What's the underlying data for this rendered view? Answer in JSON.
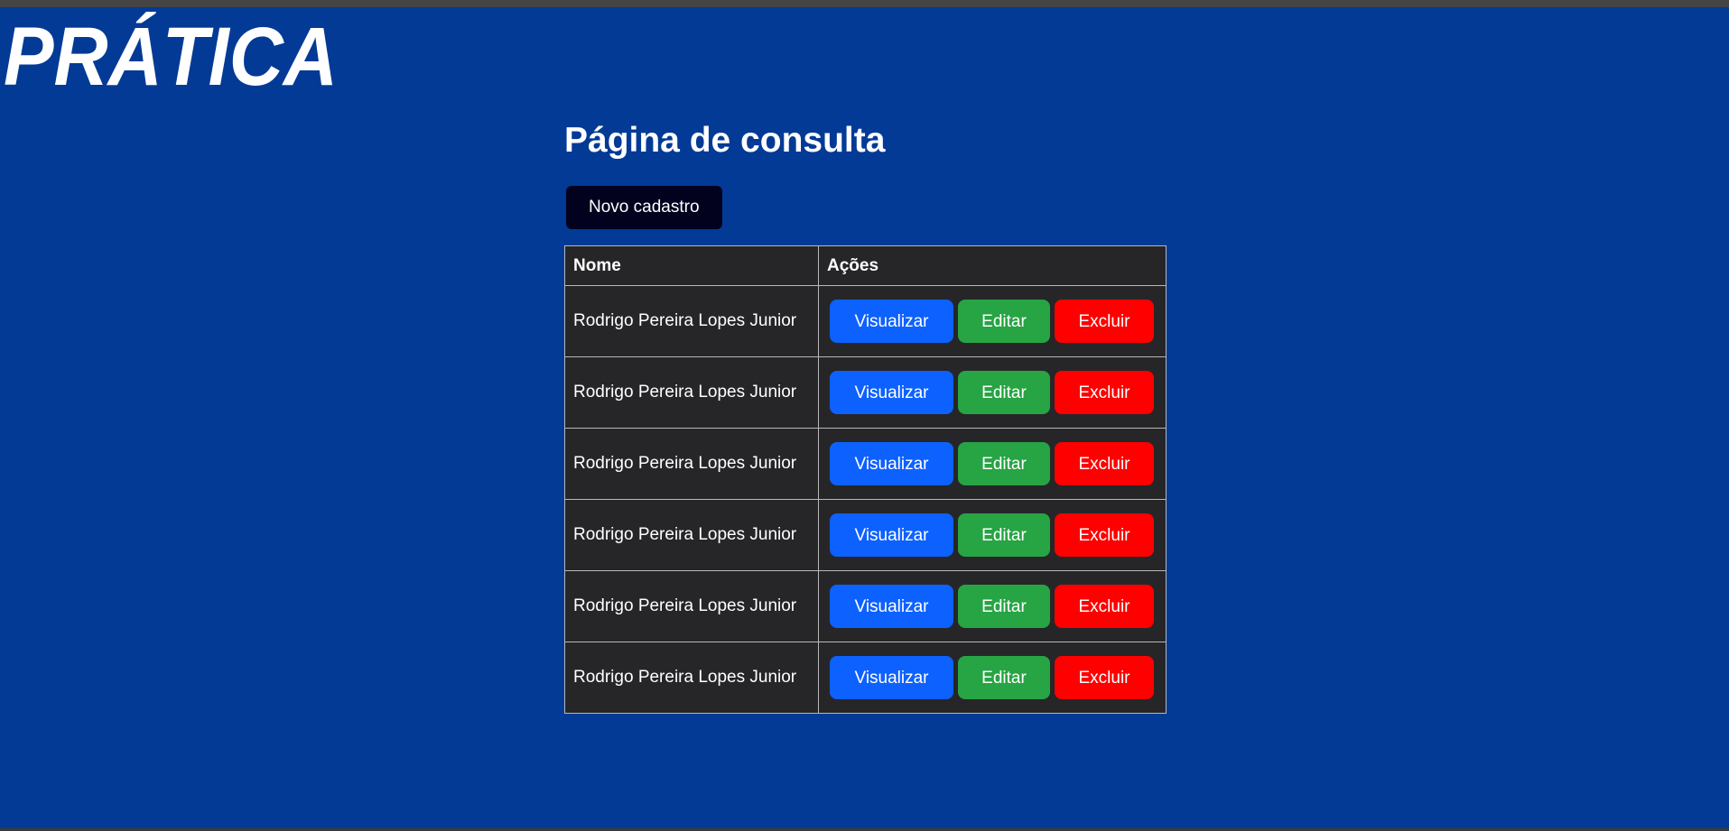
{
  "brand": {
    "logo_text": "PRÁTICA",
    "logo_color": "#ffffff"
  },
  "page": {
    "title": "Página de consulta",
    "new_button_label": "Novo cadastro",
    "background_color": "#033a96"
  },
  "table": {
    "columns": [
      "Nome",
      "Ações"
    ],
    "rows": [
      {
        "name": "Rodrigo Pereira Lopes Junior"
      },
      {
        "name": "Rodrigo Pereira Lopes Junior"
      },
      {
        "name": "Rodrigo Pereira Lopes Junior"
      },
      {
        "name": "Rodrigo Pereira Lopes Junior"
      },
      {
        "name": "Rodrigo Pereira Lopes Junior"
      },
      {
        "name": "Rodrigo Pereira Lopes Junior"
      }
    ],
    "actions": {
      "view_label": "Visualizar",
      "edit_label": "Editar",
      "delete_label": "Excluir"
    }
  },
  "colors": {
    "view_button": "#0d61ff",
    "edit_button": "#27a444",
    "delete_button": "#ff0000",
    "new_button": "#02021e",
    "table_background": "#262628"
  }
}
